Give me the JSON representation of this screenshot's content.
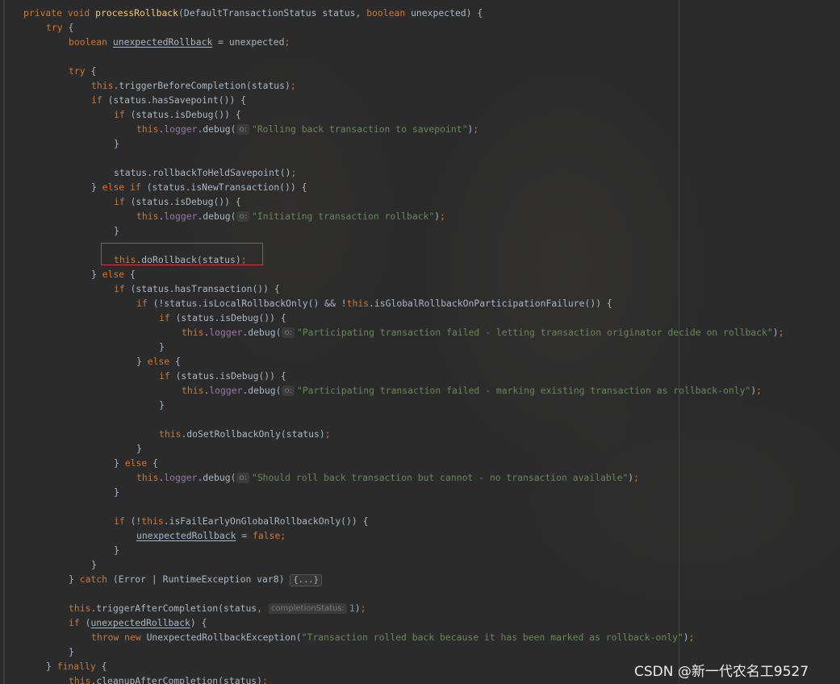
{
  "editor": {
    "lines": [
      {
        "indent": 0,
        "tokens": [
          [
            "kw",
            "private void "
          ],
          [
            "fn",
            "processRollback"
          ],
          [
            "pl",
            "(DefaultTransactionStatus status, "
          ],
          [
            "kw",
            "boolean "
          ],
          [
            "pl",
            "unexpected) {"
          ]
        ]
      },
      {
        "indent": 1,
        "tokens": [
          [
            "kw",
            "try "
          ],
          [
            "pl",
            "{"
          ]
        ]
      },
      {
        "indent": 2,
        "tokens": [
          [
            "kw",
            "boolean "
          ],
          [
            "ul",
            "unexpectedRollback"
          ],
          [
            "pl",
            " = unexpected"
          ],
          [
            "kw",
            ";"
          ]
        ]
      },
      {
        "indent": 0,
        "tokens": []
      },
      {
        "indent": 2,
        "tokens": [
          [
            "kw",
            "try "
          ],
          [
            "pl",
            "{"
          ]
        ]
      },
      {
        "indent": 3,
        "tokens": [
          [
            "kw",
            "this"
          ],
          [
            "pl",
            ".triggerBeforeCompletion(status)"
          ],
          [
            "kw",
            ";"
          ]
        ]
      },
      {
        "indent": 3,
        "tokens": [
          [
            "kw",
            "if "
          ],
          [
            "pl",
            "(status.hasSavepoint()) {"
          ]
        ]
      },
      {
        "indent": 4,
        "tokens": [
          [
            "kw",
            "if "
          ],
          [
            "pl",
            "(status.isDebug()) {"
          ]
        ]
      },
      {
        "indent": 5,
        "tokens": [
          [
            "kw",
            "this"
          ],
          [
            "pl",
            "."
          ],
          [
            "fd",
            "logger"
          ],
          [
            "pl",
            ".debug("
          ],
          [
            "hint",
            "o:"
          ],
          [
            "st",
            "\"Rolling back transaction to savepoint\""
          ],
          [
            "pl",
            ")"
          ],
          [
            "kw",
            ";"
          ]
        ]
      },
      {
        "indent": 4,
        "tokens": [
          [
            "pl",
            "}"
          ]
        ]
      },
      {
        "indent": 0,
        "tokens": []
      },
      {
        "indent": 4,
        "tokens": [
          [
            "pl",
            "status.rollbackToHeldSavepoint()"
          ],
          [
            "kw",
            ";"
          ]
        ]
      },
      {
        "indent": 3,
        "tokens": [
          [
            "pl",
            "} "
          ],
          [
            "kw",
            "else if "
          ],
          [
            "pl",
            "(status.isNewTransaction()) {"
          ]
        ]
      },
      {
        "indent": 4,
        "tokens": [
          [
            "kw",
            "if "
          ],
          [
            "pl",
            "(status.isDebug()) {"
          ]
        ]
      },
      {
        "indent": 5,
        "tokens": [
          [
            "kw",
            "this"
          ],
          [
            "pl",
            "."
          ],
          [
            "fd",
            "logger"
          ],
          [
            "pl",
            ".debug("
          ],
          [
            "hint",
            "o:"
          ],
          [
            "st",
            "\"Initiating transaction rollback\""
          ],
          [
            "pl",
            ")"
          ],
          [
            "kw",
            ";"
          ]
        ]
      },
      {
        "indent": 4,
        "tokens": [
          [
            "pl",
            "}"
          ]
        ]
      },
      {
        "indent": 0,
        "tokens": []
      },
      {
        "indent": 4,
        "tokens": [
          [
            "kw",
            "this"
          ],
          [
            "pl",
            ".doRollback(status)"
          ],
          [
            "kw",
            ";"
          ]
        ]
      },
      {
        "indent": 3,
        "tokens": [
          [
            "pl",
            "} "
          ],
          [
            "kw",
            "else "
          ],
          [
            "pl",
            "{"
          ]
        ]
      },
      {
        "indent": 4,
        "tokens": [
          [
            "kw",
            "if "
          ],
          [
            "pl",
            "(status.hasTransaction()) {"
          ]
        ]
      },
      {
        "indent": 5,
        "tokens": [
          [
            "kw",
            "if "
          ],
          [
            "pl",
            "(!status.isLocalRollbackOnly() && !"
          ],
          [
            "kw",
            "this"
          ],
          [
            "pl",
            ".isGlobalRollbackOnParticipationFailure()) {"
          ]
        ]
      },
      {
        "indent": 6,
        "tokens": [
          [
            "kw",
            "if "
          ],
          [
            "pl",
            "(status.isDebug()) {"
          ]
        ]
      },
      {
        "indent": 7,
        "tokens": [
          [
            "kw",
            "this"
          ],
          [
            "pl",
            "."
          ],
          [
            "fd",
            "logger"
          ],
          [
            "pl",
            ".debug("
          ],
          [
            "hint",
            "o:"
          ],
          [
            "st",
            "\"Participating transaction failed - letting transaction originator decide on rollback\""
          ],
          [
            "pl",
            ")"
          ],
          [
            "kw",
            ";"
          ]
        ]
      },
      {
        "indent": 6,
        "tokens": [
          [
            "pl",
            "}"
          ]
        ]
      },
      {
        "indent": 5,
        "tokens": [
          [
            "pl",
            "} "
          ],
          [
            "kw",
            "else "
          ],
          [
            "pl",
            "{"
          ]
        ]
      },
      {
        "indent": 6,
        "tokens": [
          [
            "kw",
            "if "
          ],
          [
            "pl",
            "(status.isDebug()) {"
          ]
        ]
      },
      {
        "indent": 7,
        "tokens": [
          [
            "kw",
            "this"
          ],
          [
            "pl",
            "."
          ],
          [
            "fd",
            "logger"
          ],
          [
            "pl",
            ".debug("
          ],
          [
            "hint",
            "o:"
          ],
          [
            "st",
            "\"Participating transaction failed - marking existing transaction as rollback-only\""
          ],
          [
            "pl",
            ")"
          ],
          [
            "kw",
            ";"
          ]
        ]
      },
      {
        "indent": 6,
        "tokens": [
          [
            "pl",
            "}"
          ]
        ]
      },
      {
        "indent": 0,
        "tokens": []
      },
      {
        "indent": 6,
        "tokens": [
          [
            "kw",
            "this"
          ],
          [
            "pl",
            ".doSetRollbackOnly(status)"
          ],
          [
            "kw",
            ";"
          ]
        ]
      },
      {
        "indent": 5,
        "tokens": [
          [
            "pl",
            "}"
          ]
        ]
      },
      {
        "indent": 4,
        "tokens": [
          [
            "pl",
            "} "
          ],
          [
            "kw",
            "else "
          ],
          [
            "pl",
            "{"
          ]
        ]
      },
      {
        "indent": 5,
        "tokens": [
          [
            "kw",
            "this"
          ],
          [
            "pl",
            "."
          ],
          [
            "fd",
            "logger"
          ],
          [
            "pl",
            ".debug("
          ],
          [
            "hint",
            "o:"
          ],
          [
            "st",
            "\"Should roll back transaction but cannot - no transaction available\""
          ],
          [
            "pl",
            ")"
          ],
          [
            "kw",
            ";"
          ]
        ]
      },
      {
        "indent": 4,
        "tokens": [
          [
            "pl",
            "}"
          ]
        ]
      },
      {
        "indent": 0,
        "tokens": []
      },
      {
        "indent": 4,
        "tokens": [
          [
            "kw",
            "if "
          ],
          [
            "pl",
            "(!"
          ],
          [
            "kw",
            "this"
          ],
          [
            "pl",
            ".isFailEarlyOnGlobalRollbackOnly()) {"
          ]
        ]
      },
      {
        "indent": 5,
        "tokens": [
          [
            "ul",
            "unexpectedRollback"
          ],
          [
            "pl",
            " = "
          ],
          [
            "kw",
            "false;"
          ]
        ]
      },
      {
        "indent": 4,
        "tokens": [
          [
            "pl",
            "}"
          ]
        ]
      },
      {
        "indent": 3,
        "tokens": [
          [
            "pl",
            "}"
          ]
        ]
      },
      {
        "indent": 2,
        "tokens": [
          [
            "pl",
            "} "
          ],
          [
            "kw",
            "catch "
          ],
          [
            "pl",
            "(Error | RuntimeException var8) "
          ],
          [
            "fold",
            "{...}"
          ]
        ]
      },
      {
        "indent": 0,
        "tokens": []
      },
      {
        "indent": 2,
        "tokens": [
          [
            "kw",
            "this"
          ],
          [
            "pl",
            ".triggerAfterCompletion(status"
          ],
          [
            "kw",
            ", "
          ],
          [
            "hint",
            "completionStatus:"
          ],
          [
            "nm",
            "1"
          ],
          [
            "pl",
            ")"
          ],
          [
            "kw",
            ";"
          ]
        ]
      },
      {
        "indent": 2,
        "tokens": [
          [
            "kw",
            "if "
          ],
          [
            "pl",
            "("
          ],
          [
            "ul",
            "unexpectedRollback"
          ],
          [
            "pl",
            ") {"
          ]
        ]
      },
      {
        "indent": 3,
        "tokens": [
          [
            "kw",
            "throw new "
          ],
          [
            "pl",
            "UnexpectedRollbackException("
          ],
          [
            "st",
            "\"Transaction rolled back because it has been marked as rollback-only\""
          ],
          [
            "pl",
            ")"
          ],
          [
            "kw",
            ";"
          ]
        ]
      },
      {
        "indent": 2,
        "tokens": [
          [
            "pl",
            "}"
          ]
        ]
      },
      {
        "indent": 1,
        "tokens": [
          [
            "pl",
            "} "
          ],
          [
            "kw",
            "finally "
          ],
          [
            "pl",
            "{"
          ]
        ]
      },
      {
        "indent": 2,
        "tokens": [
          [
            "kw",
            "this"
          ],
          [
            "pl",
            ".cleanupAfterCompletion(status)"
          ],
          [
            "kw",
            ";"
          ]
        ]
      }
    ]
  },
  "highlight": {
    "color": "#e0353c"
  },
  "watermark": "CSDN @新一代农名工9527",
  "colors": {
    "background": "#2b2b2b",
    "keyword": "#cc7832",
    "method": "#ffc66d",
    "string": "#6a8759",
    "field": "#9876aa",
    "number": "#6897bb",
    "text": "#a9b7c6"
  }
}
